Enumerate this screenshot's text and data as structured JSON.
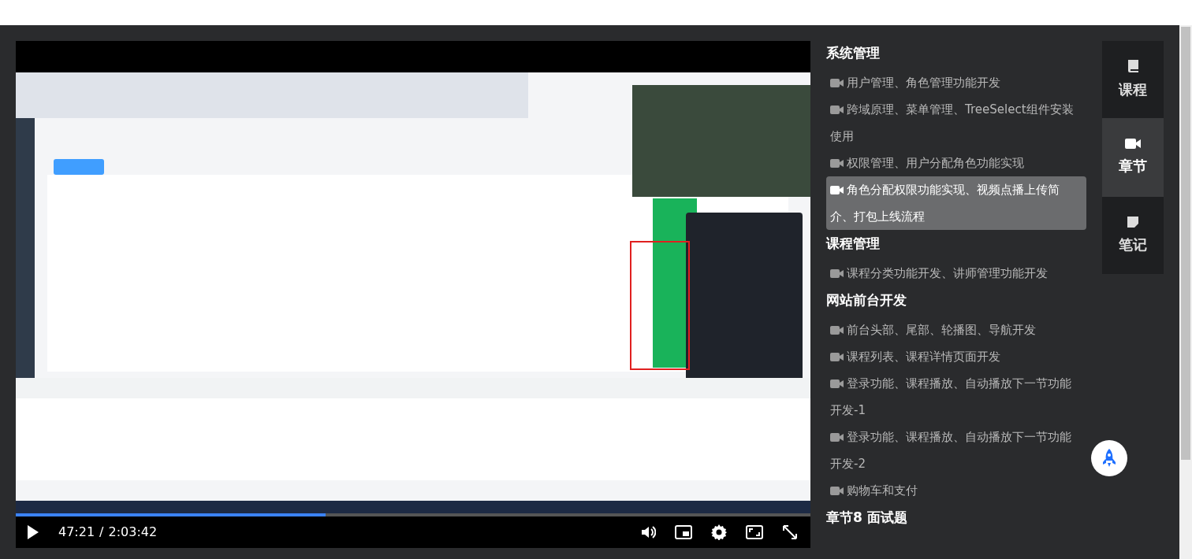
{
  "player": {
    "playing": false,
    "current_time": "47:21",
    "separator": "/",
    "duration": "2:03:42",
    "progress": {
      "level": 0.39
    }
  },
  "chapters": [
    {
      "title": "系统管理",
      "items": [
        {
          "label": "用户管理、角色管理功能开发",
          "selected": false
        },
        {
          "label": "跨域原理、菜单管理、TreeSelect组件安装使用",
          "selected": false
        },
        {
          "label": "权限管理、用户分配角色功能实现",
          "selected": false
        },
        {
          "label": "角色分配权限功能实现、视频点播上传简介、打包上线流程",
          "selected": true
        }
      ]
    },
    {
      "title": "课程管理",
      "items": [
        {
          "label": "课程分类功能开发、讲师管理功能开发",
          "selected": false
        }
      ]
    },
    {
      "title": "网站前台开发",
      "items": [
        {
          "label": "前台头部、尾部、轮播图、导航开发",
          "selected": false
        },
        {
          "label": "课程列表、课程详情页面开发",
          "selected": false
        },
        {
          "label": "登录功能、课程播放、自动播放下一节功能开发-1",
          "selected": false
        },
        {
          "label": "登录功能、课程播放、自动播放下一节功能开发-2",
          "selected": false
        },
        {
          "label": "购物车和支付",
          "selected": false
        }
      ]
    },
    {
      "title": "章节8 面试题"
    }
  ],
  "side_tabs": [
    {
      "kind": "book",
      "label": "课程",
      "selected": false
    },
    {
      "kind": "video",
      "label": "章节",
      "selected": true
    },
    {
      "kind": "note",
      "label": "笔记",
      "selected": false
    }
  ]
}
